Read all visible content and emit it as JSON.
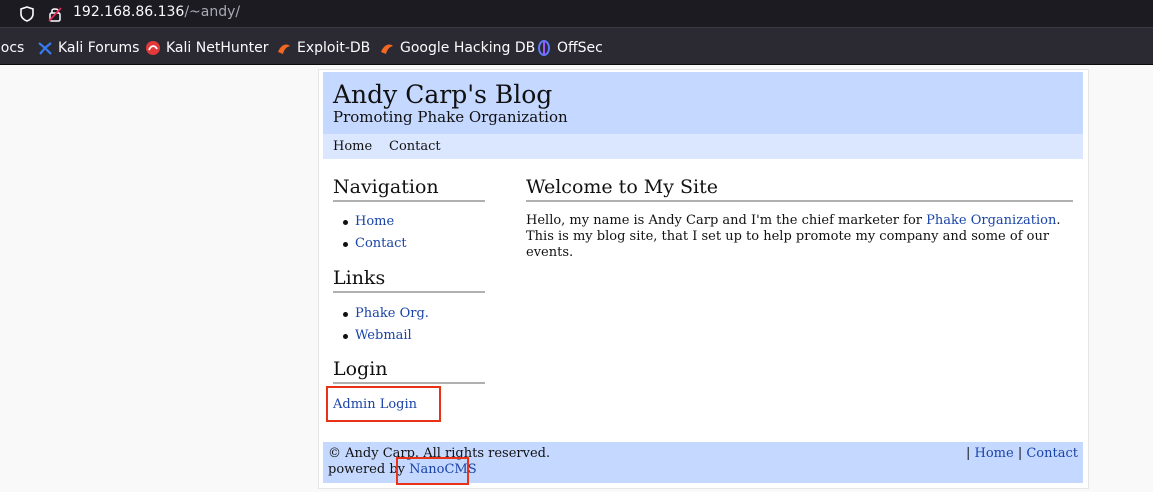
{
  "browser": {
    "url_host": "192.168.86.136",
    "url_path": "/~andy/",
    "bookmarks": [
      {
        "label": "Docs",
        "icon": "docs-icon"
      },
      {
        "label": "Kali Forums",
        "icon": "kali-forums-icon"
      },
      {
        "label": "Kali NetHunter",
        "icon": "kali-nethunter-icon"
      },
      {
        "label": "Exploit-DB",
        "icon": "exploit-db-icon"
      },
      {
        "label": "Google Hacking DB",
        "icon": "google-hacking-db-icon"
      },
      {
        "label": "OffSec",
        "icon": "offsec-icon"
      }
    ]
  },
  "site": {
    "title": "Andy Carp's Blog",
    "subtitle": "Promoting Phake Organization",
    "topnav": [
      "Home",
      "Contact"
    ]
  },
  "sidebar": {
    "navigation": {
      "heading": "Navigation",
      "items": [
        "Home",
        "Contact"
      ]
    },
    "links": {
      "heading": "Links",
      "items": [
        "Phake Org.",
        "Webmail"
      ]
    },
    "login": {
      "heading": "Login",
      "link": "Admin Login"
    }
  },
  "main": {
    "heading": "Welcome to My Site",
    "text_before": "Hello, my name is Andy Carp and I'm the chief marketer for ",
    "link": "Phake Organization",
    "text_after": ". This is my blog site, that I set up to help promote my company and some of our events."
  },
  "footer": {
    "copyright": "© Andy Carp. All rights reserved.",
    "powered_prefix": "powered by ",
    "powered_link": "NanoCMS",
    "sep": "|",
    "links": [
      "Home",
      "Contact"
    ]
  },
  "colors": {
    "header_bg": "#c5d8ff",
    "nav_bg": "#dbe7ff",
    "link": "#1a44a8",
    "highlight": "#e8321a"
  }
}
